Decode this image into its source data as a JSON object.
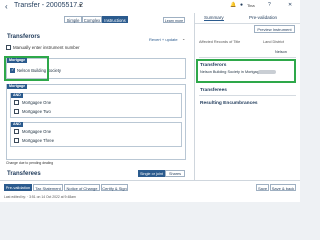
{
  "header": {
    "title": "Transfer - 20005517.2",
    "user": "Tina"
  },
  "left": {
    "views": [
      "Simple",
      "Complex",
      "Instructions"
    ],
    "active_view": "Instructions",
    "learn_link": "Learn more",
    "manual_label": "Manually enter instrument number",
    "transferors_title": "Transferors",
    "revert_label": "Revert + update",
    "mortgage_tag": "Mortgage",
    "mortgage_party": "Nelson Building Society",
    "joint_tag": "Mortgage",
    "and_tag": "AND",
    "group1": [
      "Mortgagee One",
      "Mortgagee Two"
    ],
    "group2": [
      "Mortgagee One",
      "Mortgagee Three"
    ],
    "footnote": "Change due to pending dealing",
    "order_buttons": [
      "Single or joint",
      "Shares"
    ],
    "transferees_title": "Transferees"
  },
  "right": {
    "tabs": [
      "Summary",
      "Pre-validation"
    ],
    "preview_label": "Preview Instrument",
    "affected_label": "Affected Records of Title",
    "affected_col2": "Land District",
    "affected_value": "Nelson",
    "transferors_title": "Transferors",
    "transferors_text": "Nelson Building Society in Mortgage",
    "transferees_title": "Transferees",
    "encumbrances_title": "Resulting Encumbrances"
  },
  "footer": {
    "tabs": [
      "Pre-validation",
      "Tax Statement",
      "Notice of Change",
      "Certify & Sign"
    ],
    "save": "Save",
    "save_back": "Save & back",
    "status": "Last edited by: · 3:51 on 14 Oct 2022 at 9:48am"
  }
}
